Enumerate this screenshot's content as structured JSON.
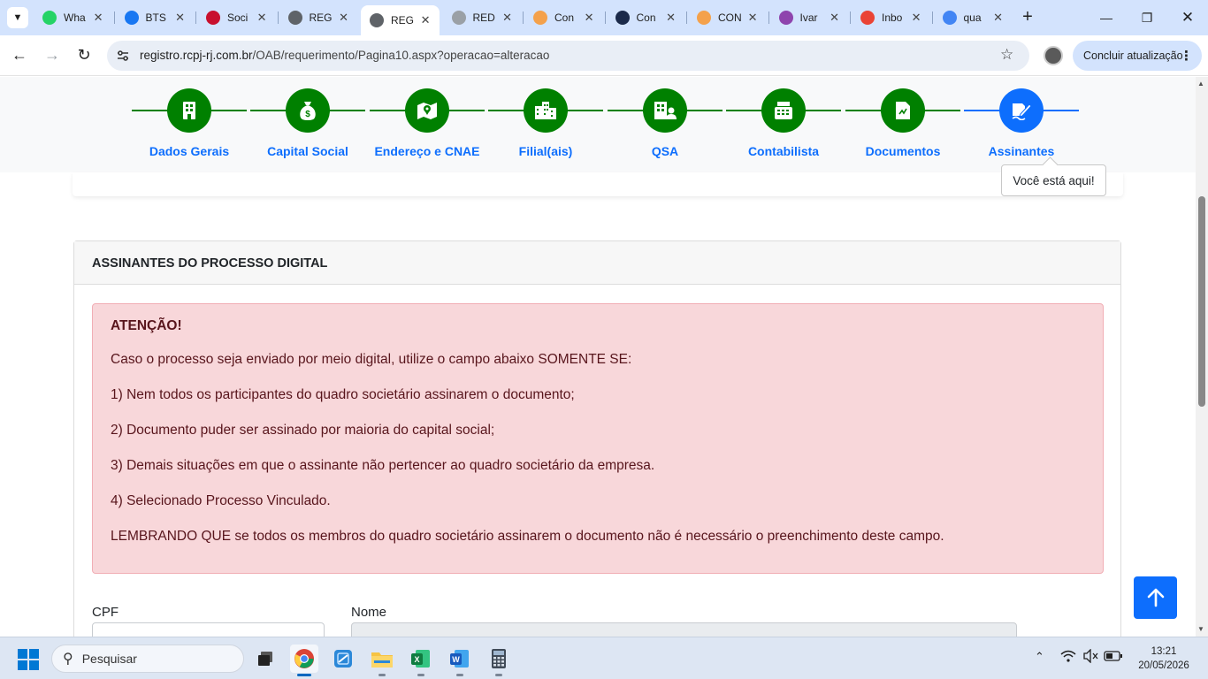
{
  "browser": {
    "tabs": [
      {
        "title": "Wha",
        "favicon": "whatsapp-icon",
        "color": "#25d366"
      },
      {
        "title": "BTS",
        "favicon": "facebook-icon",
        "color": "#1877f2"
      },
      {
        "title": "Soci",
        "favicon": "oab-icon",
        "color": "#c8102e"
      },
      {
        "title": "REG",
        "favicon": "globe-icon",
        "color": "#5f6368"
      },
      {
        "title": "REG",
        "favicon": "globe-icon",
        "color": "#5f6368",
        "active": true
      },
      {
        "title": "RED",
        "favicon": "document-icon",
        "color": "#9aa0a6"
      },
      {
        "title": "Con",
        "favicon": "g-icon",
        "color": "#f4a14b"
      },
      {
        "title": "Con",
        "favicon": "c-icon",
        "color": "#1b2a4a"
      },
      {
        "title": "CON",
        "favicon": "g-icon",
        "color": "#f4a14b"
      },
      {
        "title": "Ivar",
        "favicon": "v-icon",
        "color": "#8e44ad"
      },
      {
        "title": "Inbo",
        "favicon": "gmail-icon",
        "color": "#ea4335"
      },
      {
        "title": "qua",
        "favicon": "google-icon",
        "color": "#4285f4"
      }
    ],
    "url_host": "registro.rcpj-rj.com.br",
    "url_path": "/OAB/requerimento/Pagina10.aspx?operacao=alteracao",
    "update_button": "Concluir atualização"
  },
  "steps": [
    {
      "label": "Dados Gerais",
      "icon": "building-icon",
      "state": "done"
    },
    {
      "label": "Capital Social",
      "icon": "money-bag-icon",
      "state": "done"
    },
    {
      "label": "Endereço e CNAE",
      "icon": "map-icon",
      "state": "done"
    },
    {
      "label": "Filial(ais)",
      "icon": "city-icon",
      "state": "done"
    },
    {
      "label": "QSA",
      "icon": "building-user-icon",
      "state": "done"
    },
    {
      "label": "Contabilista",
      "icon": "cash-register-icon",
      "state": "done"
    },
    {
      "label": "Documentos",
      "icon": "file-icon",
      "state": "done"
    },
    {
      "label": "Assinantes",
      "icon": "signature-icon",
      "state": "current"
    }
  ],
  "tooltip": "Você está aqui!",
  "card": {
    "header": "ASSINANTES DO PROCESSO DIGITAL",
    "alert": {
      "title": "ATENÇÃO!",
      "lines": [
        "Caso o processo seja enviado por meio digital, utilize o campo abaixo SOMENTE SE:",
        "1) Nem todos os participantes do quadro societário assinarem o documento;",
        "2) Documento puder ser assinado por maioria do capital social;",
        "3) Demais situações em que o assinante não pertencer ao quadro societário da empresa.",
        "4) Selecionado Processo Vinculado.",
        "LEMBRANDO QUE se todos os membros do quadro societário assinarem o documento não é necessário o preenchimento deste campo."
      ]
    },
    "cpf_label": "CPF",
    "nome_label": "Nome"
  },
  "colors": {
    "step_done": "#008000",
    "step_current": "#0d6efd",
    "step_label": "#0d6efd",
    "alert_bg": "#f8d7da",
    "alert_text": "#58151c"
  },
  "taskbar": {
    "search_placeholder": "Pesquisar",
    "time": "13:21",
    "date": "20/05/2026",
    "apps": [
      "task-view-icon",
      "chrome-icon",
      "remote-desktop-icon",
      "file-explorer-icon",
      "excel-icon",
      "word-icon",
      "calculator-icon"
    ]
  }
}
